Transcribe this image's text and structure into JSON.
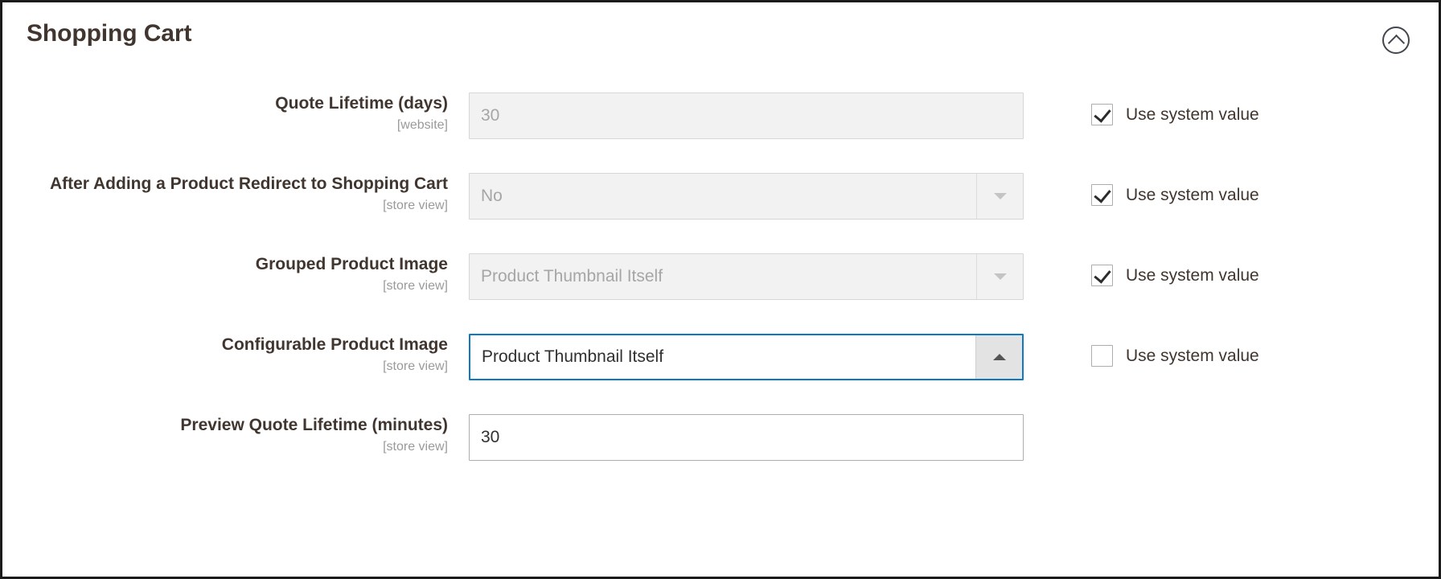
{
  "section": {
    "title": "Shopping Cart",
    "collapse_icon": "chevron-up-circle-icon",
    "collapsed": false
  },
  "colors": {
    "accent_focus_border": "#0e7ac4",
    "title_text": "#41362f",
    "scope_text": "#9a9a9a",
    "disabled_bg": "#f2f2f2",
    "disabled_text": "#a6a6a6",
    "input_border": "#adadad",
    "frame_border": "#1b1b1b"
  },
  "system_value_label": "Use system value",
  "fields": [
    {
      "label": "Quote Lifetime (days)",
      "scope": "[website]",
      "type": "text",
      "value": "30",
      "disabled": true,
      "focused": false,
      "has_system_value": true,
      "system_value_checked": true
    },
    {
      "label": "After Adding a Product Redirect to Shopping Cart",
      "scope": "[store view]",
      "type": "select",
      "value": "No",
      "disabled": true,
      "focused": false,
      "arrow": "chevron-down-icon",
      "has_system_value": true,
      "system_value_checked": true
    },
    {
      "label": "Grouped Product Image",
      "scope": "[store view]",
      "type": "select",
      "value": "Product Thumbnail Itself",
      "disabled": true,
      "focused": false,
      "arrow": "chevron-down-icon",
      "has_system_value": true,
      "system_value_checked": true
    },
    {
      "label": "Configurable Product Image",
      "scope": "[store view]",
      "type": "select",
      "value": "Product Thumbnail Itself",
      "disabled": false,
      "focused": true,
      "arrow": "chevron-up-icon",
      "has_system_value": true,
      "system_value_checked": false
    },
    {
      "label": "Preview Quote Lifetime (minutes)",
      "scope": "[store view]",
      "type": "text",
      "value": "30",
      "disabled": false,
      "focused": false,
      "has_system_value": false,
      "system_value_checked": false
    }
  ]
}
